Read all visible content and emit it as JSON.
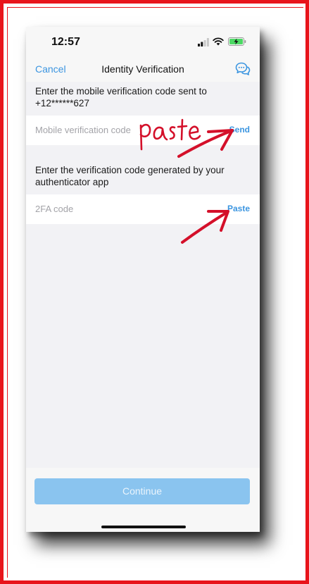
{
  "status_bar": {
    "time": "12:57"
  },
  "nav": {
    "cancel_label": "Cancel",
    "title": "Identity Verification",
    "chat_icon": "chat-bubbles-icon"
  },
  "mobile_section": {
    "instruction": "Enter the mobile verification code sent to +12******627",
    "placeholder": "Mobile verification code",
    "action_label": "Send"
  },
  "twofa_section": {
    "instruction": "Enter the verification code generated by your authenticator app",
    "placeholder": "2FA code",
    "action_label": "Paste"
  },
  "footer": {
    "continue_label": "Continue"
  },
  "annotation": {
    "handwritten_text": "paste",
    "color": "#d4102a"
  },
  "colors": {
    "accent": "#3b95e0",
    "button_disabled": "#8ac4ef",
    "frame_border": "#e8141b"
  }
}
